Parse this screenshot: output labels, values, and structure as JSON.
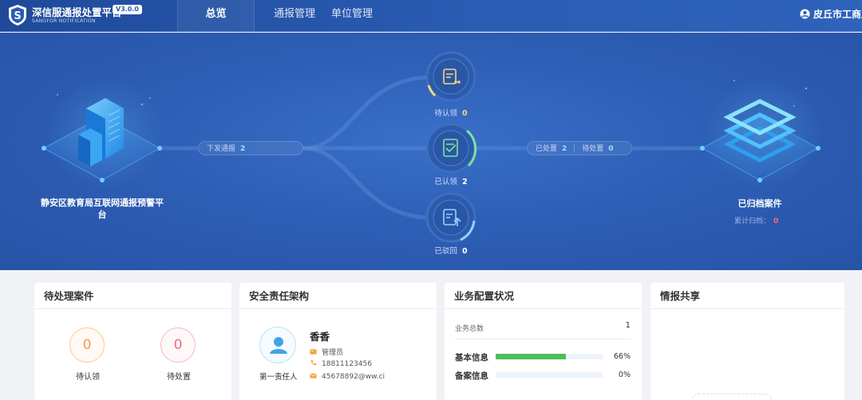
{
  "app": {
    "title": "深信服通报处置平台",
    "version": "V3.0.0",
    "subtitle": "SANGFOR NOTIFICATION"
  },
  "nav": {
    "tabs": [
      {
        "label": "总览",
        "active": true
      },
      {
        "label": "通报管理",
        "active": false
      },
      {
        "label": "单位管理",
        "active": false
      }
    ],
    "user": "皮丘市工商局"
  },
  "flow": {
    "source_title": "静安区教育局互联网通报预警平台",
    "issued_label": "下发通报",
    "issued_count": "2",
    "nodes": [
      {
        "label": "待认领",
        "count": "0",
        "color": "#f5d77a"
      },
      {
        "label": "已认领",
        "count": "2",
        "color": "#7de39a"
      },
      {
        "label": "已驳回",
        "count": "0",
        "color": "#8fd4ff"
      }
    ],
    "handled_label": "已处置",
    "handled_count": "2",
    "pending_label": "待处置",
    "pending_count": "0",
    "archive_title": "已归档案件",
    "archive_total_label": "累计归档：",
    "archive_total": "0"
  },
  "cards": {
    "pending": {
      "title": "待处理案件",
      "items": [
        {
          "label": "待认领",
          "value": "0"
        },
        {
          "label": "待处置",
          "value": "0"
        }
      ]
    },
    "security": {
      "title": "安全责任架构",
      "role": "第一责任人",
      "name": "香香",
      "position": "管理员",
      "phone": "18811123456",
      "email": "45678892@ww.ci"
    },
    "business": {
      "title": "业务配置状况",
      "total_label": "业务总数",
      "total": "1",
      "rows": [
        {
          "label": "基本信息",
          "percent": 66,
          "percent_text": "66%"
        },
        {
          "label": "备案信息",
          "percent": 0,
          "percent_text": "0%"
        }
      ]
    },
    "intel": {
      "title": "情报共享"
    }
  },
  "colors": {
    "primary": "#2a5cb3",
    "accent_green": "#4cbe5c",
    "accent_orange": "#f39a4a",
    "accent_red": "#ee6b80"
  }
}
